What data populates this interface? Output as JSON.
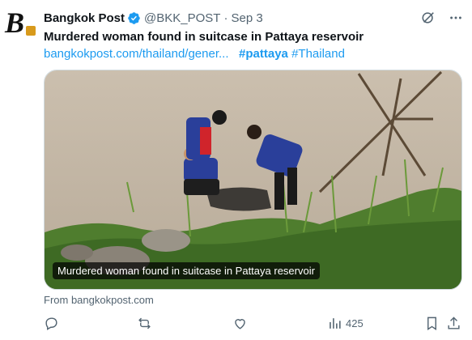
{
  "author": {
    "name": "Bangkok Post",
    "handle": "@BKK_POST",
    "separator": "·",
    "date": "Sep 3",
    "avatar_letter": "B"
  },
  "tweet": {
    "title": "Murdered woman found in suitcase in Pattaya reservoir",
    "link": "bangkokpost.com/thailand/gener...",
    "hashtag1": "#pattaya",
    "hashtag2": "#Thailand"
  },
  "card": {
    "caption": "Murdered woman found in suitcase in Pattaya reservoir",
    "source": "From bangkokpost.com"
  },
  "actions": {
    "views": "425"
  },
  "icons": {
    "verified": "verified-badge-icon",
    "grok": "grok-icon",
    "more": "more-icon",
    "reply": "reply-icon",
    "retweet": "retweet-icon",
    "like": "like-icon",
    "views": "views-icon",
    "bookmark": "bookmark-icon",
    "share": "share-icon"
  },
  "colors": {
    "accent": "#1d9bf0",
    "muted": "#536471",
    "text": "#0f1419"
  }
}
